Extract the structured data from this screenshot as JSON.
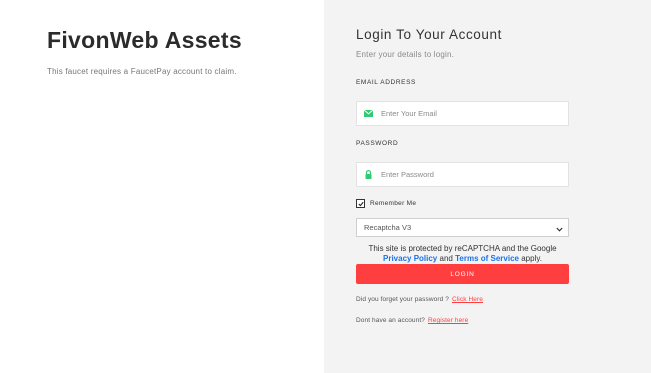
{
  "left": {
    "title": "FivonWeb Assets",
    "description": "This faucet requires a FaucetPay account to claim."
  },
  "login": {
    "title": "Login To Your Account",
    "subtitle": "Enter your details to login.",
    "email_label": "EMAIL ADDRESS",
    "email_placeholder": "Enter Your Email",
    "email_icon": "envelope-icon",
    "password_label": "PASSWORD",
    "password_placeholder": "Enter Password",
    "password_icon": "lock-icon",
    "remember_label": "Remember Me",
    "remember_checked": true,
    "captcha_selected": "Recaptcha V3",
    "recaptcha_text_1": "This site is protected by reCAPTCHA and the Google",
    "privacy_link": "Privacy Policy",
    "and_text": "and",
    "terms_link": "Terms of Service",
    "apply_text": "apply.",
    "button_label": "LOGIN",
    "forgot_text": "Did you forget your password ?",
    "forgot_link": "Click Here",
    "register_text": "Dont have an account?",
    "register_link": "Register here"
  },
  "colors": {
    "accent": "#ff3f3f",
    "icon_green": "#2ecc71",
    "link_blue": "#1a73e8",
    "panel_bg": "#f3f3f3"
  }
}
